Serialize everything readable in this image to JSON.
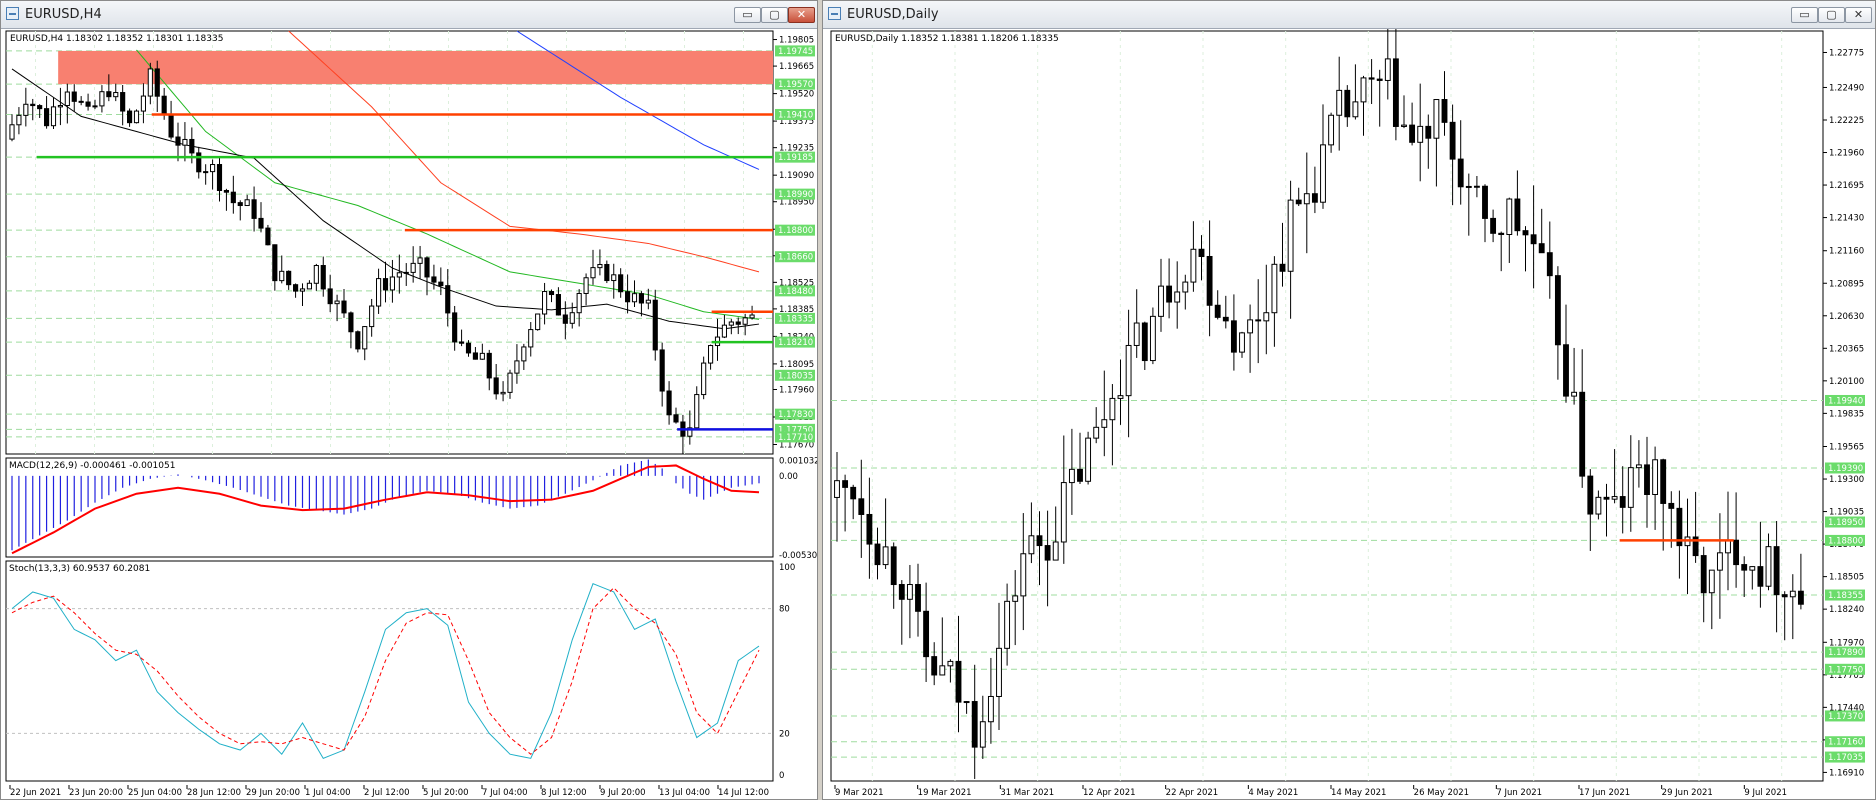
{
  "colors": {
    "bull": "#ffffff",
    "bear": "#000000",
    "grid": "#9fdc9f",
    "level_red": "#ff4000",
    "level_green": "#22c322",
    "level_blue": "#1010e0",
    "zone": "#f88070",
    "ma_black": "#000000",
    "ma_green": "#22b822",
    "ma_red": "#ff4020",
    "ma_blue": "#2040ff",
    "macd_hist": "#2020e0",
    "macd_signal": "#ff0000",
    "stoch_main": "#20b0c8",
    "stoch_signal": "#ff0000",
    "price_label_bg": "#6bdc6b"
  },
  "windows": {
    "left": {
      "title": "EURUSD,H4",
      "buttons": {
        "minimize": "▭",
        "restore": "▢",
        "close": "✕"
      }
    },
    "right": {
      "title": "EURUSD,Daily",
      "buttons": {
        "minimize": "▭",
        "restore": "▢",
        "close": "✕"
      }
    }
  },
  "chart_data": [
    {
      "type": "candlestick",
      "symbol_header": "EURUSD,H4  1.18302 1.18352 1.18301 1.18335",
      "ylim": [
        1.1762,
        1.1985
      ],
      "axis_ticks": [
        "1.19805",
        "1.19665",
        "1.19520",
        "1.19375",
        "1.19235",
        "1.19090",
        "1.18950",
        "1.18805",
        "1.18665",
        "1.18525",
        "1.18385",
        "1.18240",
        "1.18095",
        "1.17960",
        "1.17815",
        "1.17670"
      ],
      "x_labels": [
        "22 Jun 2021",
        "23 Jun 20:00",
        "25 Jun 04:00",
        "28 Jun 12:00",
        "29 Jun 20:00",
        "1 Jul 04:00",
        "2 Jul 12:00",
        "5 Jul 20:00",
        "7 Jul 04:00",
        "8 Jul 12:00",
        "9 Jul 20:00",
        "13 Jul 04:00",
        "14 Jul 12:00"
      ],
      "price_labels": [
        {
          "text": "1.19745",
          "y": 1.19745
        },
        {
          "text": "1.19570",
          "y": 1.1957
        },
        {
          "text": "1.19410",
          "y": 1.1941
        },
        {
          "text": "1.19185",
          "y": 1.19185
        },
        {
          "text": "1.18990",
          "y": 1.1899
        },
        {
          "text": "1.18800",
          "y": 1.188
        },
        {
          "text": "1.18660",
          "y": 1.1866
        },
        {
          "text": "1.18480",
          "y": 1.1848
        },
        {
          "text": "1.18335",
          "y": 1.18335
        },
        {
          "text": "1.18210",
          "y": 1.1821
        },
        {
          "text": "1.18035",
          "y": 1.18035
        },
        {
          "text": "1.17830",
          "y": 1.1783
        },
        {
          "text": "1.17750",
          "y": 1.1775
        },
        {
          "text": "1.17710",
          "y": 1.1771
        }
      ],
      "zone": [
        1.1957,
        1.19745
      ],
      "levels": [
        {
          "y": 1.1941,
          "color": "red",
          "from": 0.19,
          "to": 1.0
        },
        {
          "y": 1.19185,
          "color": "green",
          "from": 0.04,
          "to": 1.0
        },
        {
          "y": 1.188,
          "color": "red",
          "from": 0.52,
          "to": 1.0
        },
        {
          "y": 1.1837,
          "color": "red",
          "from": 0.92,
          "to": 1.0
        },
        {
          "y": 1.1821,
          "color": "green",
          "from": 0.92,
          "to": 1.0
        },
        {
          "y": 1.1775,
          "color": "blue",
          "from": 0.875,
          "to": 1.0
        }
      ],
      "anchors": [
        [
          0,
          1.1928
        ],
        [
          3,
          1.1951
        ],
        [
          6,
          1.1938
        ],
        [
          9,
          1.1957
        ],
        [
          12,
          1.194
        ],
        [
          15,
          1.1955
        ],
        [
          18,
          1.1935
        ],
        [
          21,
          1.196
        ],
        [
          24,
          1.1932
        ],
        [
          27,
          1.1918
        ],
        [
          30,
          1.1912
        ],
        [
          33,
          1.1895
        ],
        [
          36,
          1.189
        ],
        [
          39,
          1.1858
        ],
        [
          42,
          1.1848
        ],
        [
          45,
          1.186
        ],
        [
          48,
          1.184
        ],
        [
          51,
          1.1822
        ],
        [
          54,
          1.185
        ],
        [
          57,
          1.1858
        ],
        [
          60,
          1.186
        ],
        [
          63,
          1.1848
        ],
        [
          66,
          1.1815
        ],
        [
          69,
          1.181
        ],
        [
          72,
          1.179
        ],
        [
          75,
          1.1823
        ],
        [
          78,
          1.1845
        ],
        [
          81,
          1.1835
        ],
        [
          84,
          1.1855
        ],
        [
          87,
          1.1858
        ],
        [
          90,
          1.1846
        ],
        [
          93,
          1.1838
        ],
        [
          96,
          1.178
        ],
        [
          99,
          1.1773
        ],
        [
          102,
          1.1822
        ],
        [
          105,
          1.1832
        ],
        [
          108,
          1.18335
        ]
      ],
      "ma_black": [
        [
          0,
          1.1965
        ],
        [
          10,
          1.194
        ],
        [
          25,
          1.1925
        ],
        [
          35,
          1.1918
        ],
        [
          45,
          1.1885
        ],
        [
          55,
          1.186
        ],
        [
          62,
          1.185
        ],
        [
          70,
          1.184
        ],
        [
          78,
          1.1838
        ],
        [
          86,
          1.1841
        ],
        [
          95,
          1.1832
        ],
        [
          103,
          1.1828
        ],
        [
          108,
          1.18305
        ]
      ],
      "ma_green": [
        [
          18,
          1.1975
        ],
        [
          28,
          1.1932
        ],
        [
          38,
          1.1905
        ],
        [
          50,
          1.1893
        ],
        [
          60,
          1.1878
        ],
        [
          72,
          1.1858
        ],
        [
          82,
          1.1852
        ],
        [
          92,
          1.1846
        ],
        [
          100,
          1.1837
        ],
        [
          108,
          1.1833
        ]
      ],
      "ma_red": [
        [
          40,
          1.1985
        ],
        [
          52,
          1.1945
        ],
        [
          62,
          1.1905
        ],
        [
          72,
          1.1882
        ],
        [
          82,
          1.1878
        ],
        [
          92,
          1.1873
        ],
        [
          100,
          1.1866
        ],
        [
          108,
          1.1858
        ]
      ],
      "ma_blue": [
        [
          73,
          1.1985
        ],
        [
          88,
          1.195
        ],
        [
          100,
          1.1925
        ],
        [
          108,
          1.1912
        ]
      ],
      "macd": {
        "label": "MACD(12,26,9) -0.000461 -0.001051",
        "ticks": [
          "0.001032",
          "0.00",
          "-0.005305"
        ],
        "ylim": [
          -0.00545,
          0.0012
        ],
        "hist": [
          [
            0,
            -0.005
          ],
          [
            4,
            -0.004
          ],
          [
            8,
            -0.003
          ],
          [
            12,
            -0.0018
          ],
          [
            16,
            -0.0008
          ],
          [
            20,
            -0.0002
          ],
          [
            24,
            0.0001
          ],
          [
            28,
            -0.0003
          ],
          [
            32,
            -0.0008
          ],
          [
            36,
            -0.0014
          ],
          [
            40,
            -0.002
          ],
          [
            44,
            -0.0023
          ],
          [
            48,
            -0.0026
          ],
          [
            52,
            -0.0022
          ],
          [
            56,
            -0.0014
          ],
          [
            60,
            -0.001
          ],
          [
            64,
            -0.0012
          ],
          [
            68,
            -0.0018
          ],
          [
            72,
            -0.0022
          ],
          [
            76,
            -0.002
          ],
          [
            80,
            -0.0012
          ],
          [
            84,
            -0.0003
          ],
          [
            88,
            0.0007
          ],
          [
            92,
            0.0011
          ],
          [
            94,
            0.0005
          ],
          [
            96,
            -0.0005
          ],
          [
            98,
            -0.0012
          ],
          [
            100,
            -0.0016
          ],
          [
            102,
            -0.0012
          ],
          [
            104,
            -0.0008
          ],
          [
            108,
            -0.0005
          ]
        ],
        "signal": [
          [
            0,
            -0.0052
          ],
          [
            6,
            -0.0038
          ],
          [
            12,
            -0.0022
          ],
          [
            18,
            -0.0012
          ],
          [
            24,
            -0.0008
          ],
          [
            30,
            -0.0012
          ],
          [
            36,
            -0.002
          ],
          [
            42,
            -0.0023
          ],
          [
            48,
            -0.0022
          ],
          [
            54,
            -0.0016
          ],
          [
            60,
            -0.0011
          ],
          [
            66,
            -0.0013
          ],
          [
            72,
            -0.0017
          ],
          [
            78,
            -0.0016
          ],
          [
            84,
            -0.001
          ],
          [
            88,
            -0.0002
          ],
          [
            92,
            0.0006
          ],
          [
            96,
            0.0007
          ],
          [
            100,
            -0.0002
          ],
          [
            104,
            -0.001
          ],
          [
            108,
            -0.0011
          ]
        ]
      },
      "stoch": {
        "label": "Stoch(13,3,3) 60.9537 60.2081",
        "ticks": [
          "100",
          "80",
          "20",
          "0"
        ],
        "main": [
          [
            0,
            80
          ],
          [
            3,
            88
          ],
          [
            6,
            85
          ],
          [
            9,
            70
          ],
          [
            12,
            65
          ],
          [
            15,
            55
          ],
          [
            18,
            60
          ],
          [
            21,
            40
          ],
          [
            24,
            30
          ],
          [
            27,
            22
          ],
          [
            30,
            15
          ],
          [
            33,
            12
          ],
          [
            36,
            20
          ],
          [
            39,
            10
          ],
          [
            42,
            25
          ],
          [
            45,
            8
          ],
          [
            48,
            12
          ],
          [
            51,
            40
          ],
          [
            54,
            70
          ],
          [
            57,
            78
          ],
          [
            60,
            80
          ],
          [
            63,
            72
          ],
          [
            66,
            35
          ],
          [
            69,
            20
          ],
          [
            72,
            10
          ],
          [
            75,
            8
          ],
          [
            78,
            30
          ],
          [
            81,
            65
          ],
          [
            84,
            92
          ],
          [
            87,
            88
          ],
          [
            90,
            70
          ],
          [
            93,
            75
          ],
          [
            96,
            45
          ],
          [
            99,
            18
          ],
          [
            102,
            25
          ],
          [
            105,
            55
          ],
          [
            108,
            62
          ]
        ],
        "signal": [
          [
            0,
            78
          ],
          [
            3,
            83
          ],
          [
            6,
            86
          ],
          [
            9,
            78
          ],
          [
            12,
            68
          ],
          [
            15,
            60
          ],
          [
            18,
            58
          ],
          [
            21,
            50
          ],
          [
            24,
            38
          ],
          [
            27,
            28
          ],
          [
            30,
            20
          ],
          [
            33,
            15
          ],
          [
            36,
            16
          ],
          [
            39,
            15
          ],
          [
            42,
            18
          ],
          [
            45,
            15
          ],
          [
            48,
            12
          ],
          [
            51,
            28
          ],
          [
            54,
            55
          ],
          [
            57,
            73
          ],
          [
            60,
            78
          ],
          [
            63,
            77
          ],
          [
            66,
            55
          ],
          [
            69,
            30
          ],
          [
            72,
            18
          ],
          [
            75,
            10
          ],
          [
            78,
            18
          ],
          [
            81,
            45
          ],
          [
            84,
            80
          ],
          [
            87,
            90
          ],
          [
            90,
            80
          ],
          [
            93,
            73
          ],
          [
            96,
            58
          ],
          [
            99,
            30
          ],
          [
            102,
            20
          ],
          [
            105,
            40
          ],
          [
            108,
            60
          ]
        ]
      }
    },
    {
      "type": "candlestick",
      "symbol_header": "EURUSD,Daily  1.18352 1.18381 1.18206 1.18335",
      "ylim": [
        1.1684,
        1.2295
      ],
      "axis_ticks": [
        "1.22775",
        "1.22490",
        "1.22225",
        "1.21960",
        "1.21695",
        "1.21430",
        "1.21160",
        "1.20895",
        "1.20630",
        "1.20365",
        "1.20100",
        "1.19835",
        "1.19565",
        "1.19300",
        "1.19035",
        "1.18770",
        "1.18505",
        "1.18240",
        "1.17970",
        "1.17705",
        "1.17440",
        "1.17175",
        "1.16910"
      ],
      "x_labels": [
        "9 Mar 2021",
        "19 Mar 2021",
        "31 Mar 2021",
        "12 Apr 2021",
        "22 Apr 2021",
        "4 May 2021",
        "14 May 2021",
        "26 May 2021",
        "7 Jun 2021",
        "17 Jun 2021",
        "29 Jun 2021",
        "9 Jul 2021"
      ],
      "price_labels": [
        {
          "text": "1.19940",
          "y": 1.1994
        },
        {
          "text": "1.19390",
          "y": 1.1939
        },
        {
          "text": "1.18950",
          "y": 1.1895
        },
        {
          "text": "1.18800",
          "y": 1.188
        },
        {
          "text": "1.18355",
          "y": 1.18355
        },
        {
          "text": "1.17890",
          "y": 1.1789
        },
        {
          "text": "1.17750",
          "y": 1.1775
        },
        {
          "text": "1.17370",
          "y": 1.1737
        },
        {
          "text": "1.17160",
          "y": 1.1716
        },
        {
          "text": "1.17035",
          "y": 1.17035
        }
      ],
      "levels": [
        {
          "y": 1.188,
          "color": "red",
          "from": 0.795,
          "to": 0.91
        }
      ],
      "anchors": [
        [
          0,
          1.1915
        ],
        [
          3,
          1.1925
        ],
        [
          6,
          1.188
        ],
        [
          9,
          1.185
        ],
        [
          12,
          1.178
        ],
        [
          15,
          1.1765
        ],
        [
          18,
          1.173
        ],
        [
          21,
          1.179
        ],
        [
          24,
          1.187
        ],
        [
          27,
          1.188
        ],
        [
          30,
          1.1925
        ],
        [
          33,
          1.1965
        ],
        [
          36,
          1.202
        ],
        [
          39,
          1.2045
        ],
        [
          42,
          1.209
        ],
        [
          45,
          1.212
        ],
        [
          48,
          1.2075
        ],
        [
          51,
          1.204
        ],
        [
          54,
          1.208
        ],
        [
          57,
          1.214
        ],
        [
          60,
          1.2175
        ],
        [
          63,
          1.2225
        ],
        [
          66,
          1.224
        ],
        [
          69,
          1.225
        ],
        [
          72,
          1.22
        ],
        [
          75,
          1.222
        ],
        [
          78,
          1.218
        ],
        [
          81,
          1.213
        ],
        [
          84,
          1.2145
        ],
        [
          87,
          1.212
        ],
        [
          90,
          1.205
        ],
        [
          92,
          1.198
        ],
        [
          94,
          1.191
        ],
        [
          97,
          1.1905
        ],
        [
          100,
          1.1935
        ],
        [
          103,
          1.192
        ],
        [
          106,
          1.1865
        ],
        [
          109,
          1.1845
        ],
        [
          112,
          1.188
        ],
        [
          115,
          1.186
        ],
        [
          118,
          1.185
        ],
        [
          120,
          1.18335
        ]
      ]
    }
  ]
}
